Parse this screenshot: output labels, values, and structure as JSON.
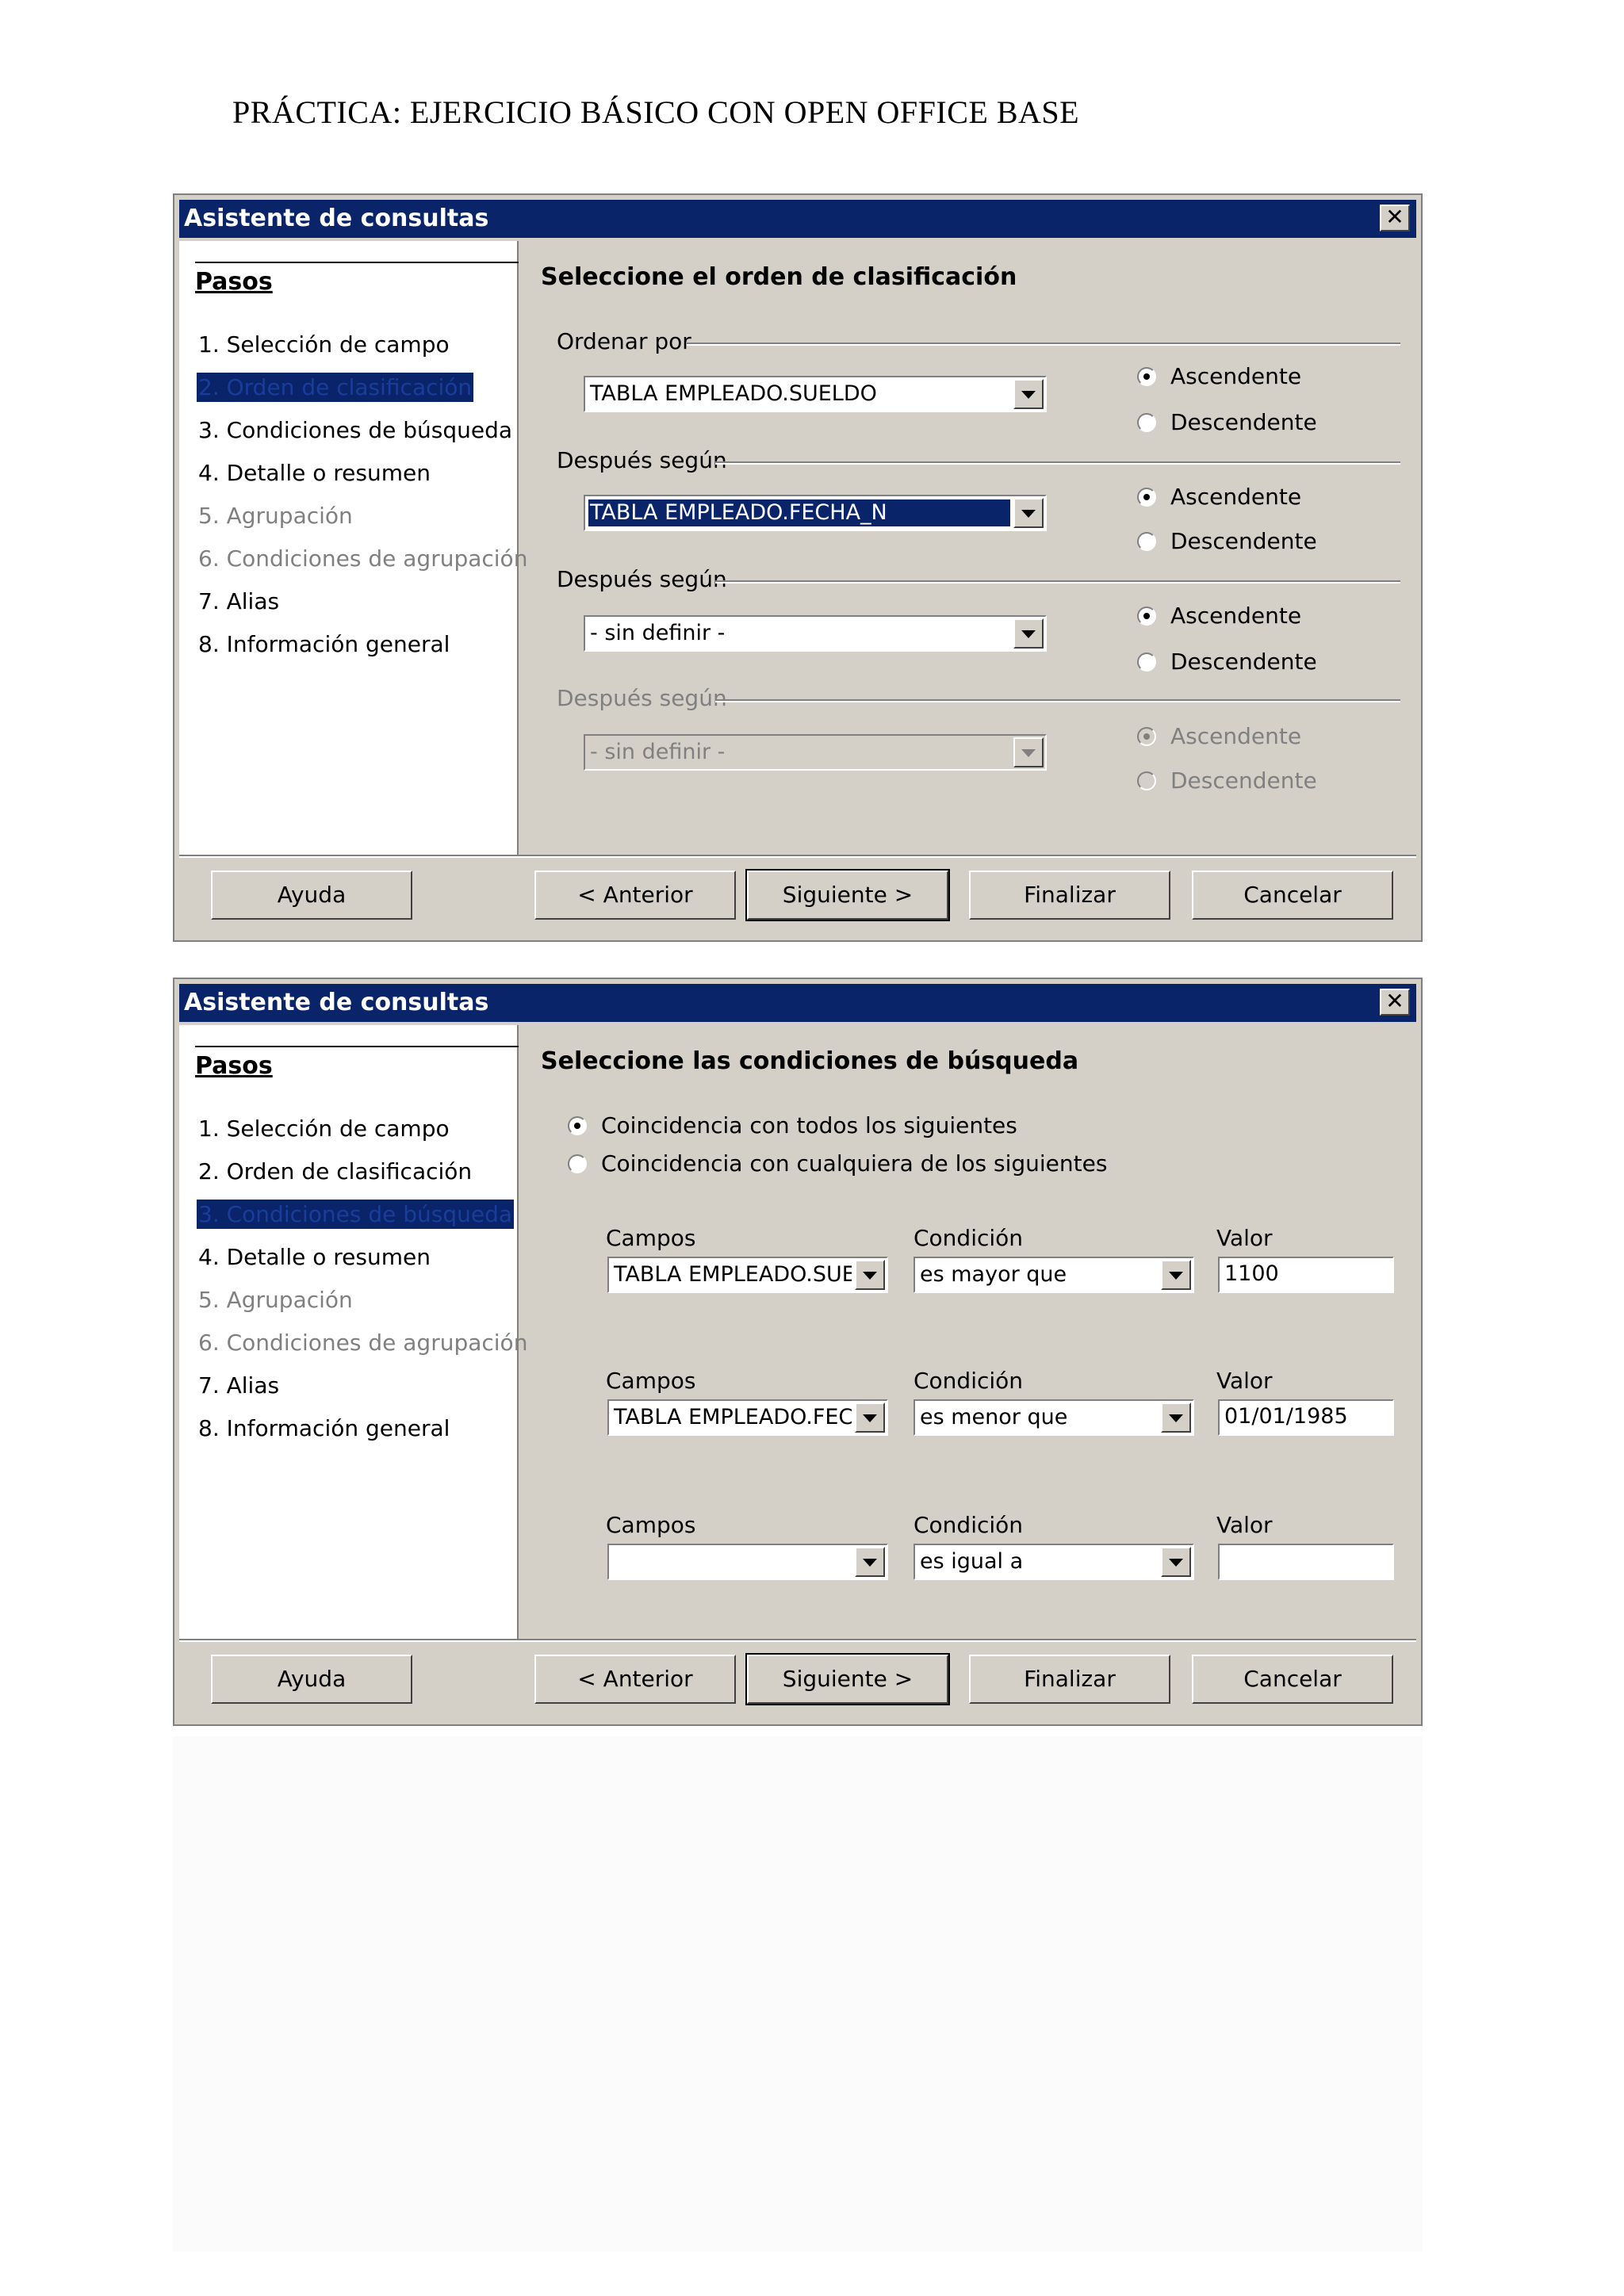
{
  "document": {
    "title": "PRÁCTICA: EJERCICIO BÁSICO CON OPEN OFFICE BASE"
  },
  "dialog1": {
    "window_title": "Asistente de consultas",
    "steps_heading": "Pasos",
    "steps": [
      "1. Selección de campo",
      "2. Orden de clasificación",
      "3. Condiciones de búsqueda",
      "4. Detalle o resumen",
      "5. Agrupación",
      "6. Condiciones de agrupación",
      "7. Alias",
      "8. Información general"
    ],
    "active_step": 2,
    "content_title": "Seleccione el orden de clasificación",
    "sort_groups": [
      {
        "label": "Ordenar por",
        "field": "TABLA EMPLEADO.SUELDO",
        "ascending": "Ascendente",
        "descending": "Descendente",
        "order": "ascending",
        "enabled": true,
        "selected": false
      },
      {
        "label": "Después según",
        "field": "TABLA EMPLEADO.FECHA_N",
        "ascending": "Ascendente",
        "descending": "Descendente",
        "order": "ascending",
        "enabled": true,
        "selected": true
      },
      {
        "label": "Después según",
        "field": "- sin definir -",
        "ascending": "Ascendente",
        "descending": "Descendente",
        "order": "ascending",
        "enabled": true,
        "selected": false
      },
      {
        "label": "Después según",
        "field": "- sin definir -",
        "ascending": "Ascendente",
        "descending": "Descendente",
        "order": "ascending",
        "enabled": false,
        "selected": false
      }
    ],
    "buttons": {
      "help": "Ayuda",
      "back": "< Anterior",
      "next": "Siguiente >",
      "finish": "Finalizar",
      "cancel": "Cancelar"
    }
  },
  "dialog2": {
    "window_title": "Asistente de consultas",
    "steps_heading": "Pasos",
    "steps": [
      "1. Selección de campo",
      "2. Orden de clasificación",
      "3. Condiciones de búsqueda",
      "4. Detalle o resumen",
      "5. Agrupación",
      "6. Condiciones de agrupación",
      "7. Alias",
      "8. Información general"
    ],
    "active_step": 3,
    "content_title": "Seleccione las condiciones de búsqueda",
    "match_options": {
      "all": "Coincidencia con todos los siguientes",
      "any": "Coincidencia con cualquiera de los siguientes",
      "selected": "all"
    },
    "conditions": [
      {
        "fields_label": "Campos",
        "condition_label": "Condición",
        "value_label": "Valor",
        "field": "TABLA EMPLEADO.SUELI",
        "condition": "es mayor que",
        "value": "1100"
      },
      {
        "fields_label": "Campos",
        "condition_label": "Condición",
        "value_label": "Valor",
        "field": "TABLA EMPLEADO.FECH",
        "condition": "es menor que",
        "value": "01/01/1985"
      },
      {
        "fields_label": "Campos",
        "condition_label": "Condición",
        "value_label": "Valor",
        "field": "",
        "condition": "es igual a",
        "value": ""
      }
    ],
    "buttons": {
      "help": "Ayuda",
      "back": "< Anterior",
      "next": "Siguiente >",
      "finish": "Finalizar",
      "cancel": "Cancelar"
    }
  },
  "colors": {
    "title_bar": "#0a246a",
    "dialog_bg": "#d4d0c8",
    "disabled_text": "#808080"
  }
}
